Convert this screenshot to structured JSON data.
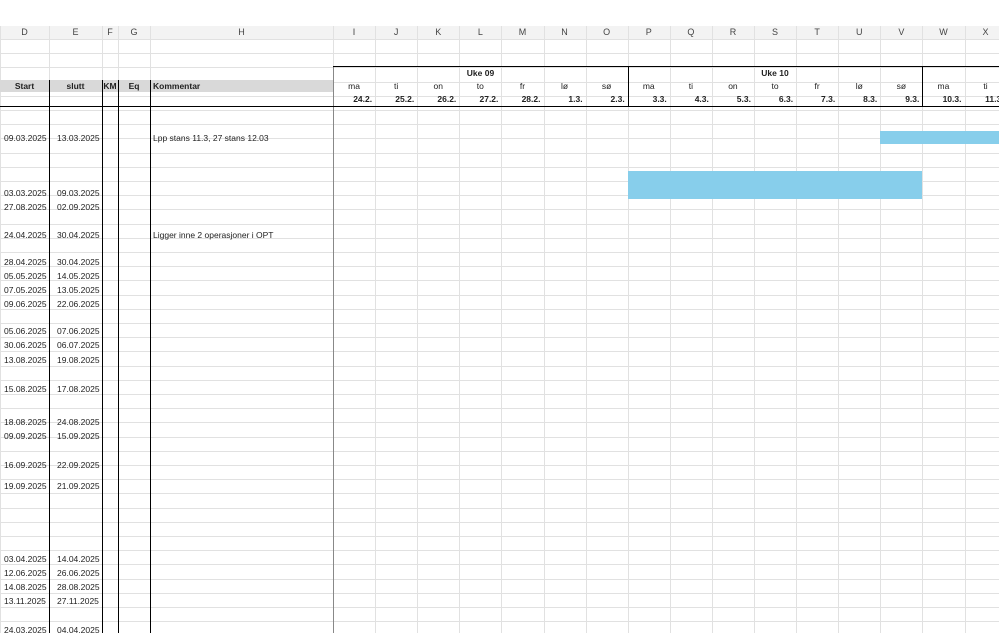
{
  "columns": {
    "letters": [
      "D",
      "E",
      "F",
      "G",
      "H",
      "I",
      "J",
      "K",
      "L",
      "M",
      "N",
      "O",
      "P",
      "Q",
      "R",
      "S",
      "T",
      "U",
      "V",
      "W",
      "X"
    ]
  },
  "headers": {
    "start": "Start",
    "slutt": "slutt",
    "km": "KM",
    "eq": "Eq",
    "kommentar": "Kommentar"
  },
  "weeks": [
    {
      "label": "Uke 09"
    },
    {
      "label": "Uke 10"
    }
  ],
  "days": [
    {
      "name": "ma",
      "date": "24.2."
    },
    {
      "name": "ti",
      "date": "25.2."
    },
    {
      "name": "on",
      "date": "26.2."
    },
    {
      "name": "to",
      "date": "27.2."
    },
    {
      "name": "fr",
      "date": "28.2."
    },
    {
      "name": "lø",
      "date": "1.3."
    },
    {
      "name": "sø",
      "date": "2.3."
    },
    {
      "name": "ma",
      "date": "3.3."
    },
    {
      "name": "ti",
      "date": "4.3."
    },
    {
      "name": "on",
      "date": "5.3."
    },
    {
      "name": "to",
      "date": "6.3."
    },
    {
      "name": "fr",
      "date": "7.3."
    },
    {
      "name": "lø",
      "date": "8.3."
    },
    {
      "name": "sø",
      "date": "9.3."
    },
    {
      "name": "ma",
      "date": "10.3."
    },
    {
      "name": "ti",
      "date": "11.3."
    }
  ],
  "rows": [
    {
      "start": "09.03.2025",
      "slutt": "13.03.2025",
      "kommentar": "Lpp stans 11.3, 27 stans 12.03"
    },
    {
      "start": "03.03.2025",
      "slutt": "09.03.2025",
      "kommentar": ""
    },
    {
      "start": "27.08.2025",
      "slutt": "02.09.2025",
      "kommentar": ""
    },
    {
      "start": "24.04.2025",
      "slutt": "30.04.2025",
      "kommentar": "Ligger inne 2 operasjoner i OPT"
    },
    {
      "start": "28.04.2025",
      "slutt": "30.04.2025",
      "kommentar": ""
    },
    {
      "start": "05.05.2025",
      "slutt": "14.05.2025",
      "kommentar": ""
    },
    {
      "start": "07.05.2025",
      "slutt": "13.05.2025",
      "kommentar": ""
    },
    {
      "start": "09.06.2025",
      "slutt": "22.06.2025",
      "kommentar": ""
    },
    {
      "start": "05.06.2025",
      "slutt": "07.06.2025",
      "kommentar": ""
    },
    {
      "start": "30.06.2025",
      "slutt": "06.07.2025",
      "kommentar": ""
    },
    {
      "start": "13.08.2025",
      "slutt": "19.08.2025",
      "kommentar": ""
    },
    {
      "start": "15.08.2025",
      "slutt": "17.08.2025",
      "kommentar": ""
    },
    {
      "start": "18.08.2025",
      "slutt": "24.08.2025",
      "kommentar": ""
    },
    {
      "start": "09.09.2025",
      "slutt": "15.09.2025",
      "kommentar": ""
    },
    {
      "start": "16.09.2025",
      "slutt": "22.09.2025",
      "kommentar": ""
    },
    {
      "start": "19.09.2025",
      "slutt": "21.09.2025",
      "kommentar": ""
    },
    {
      "start": "03.04.2025",
      "slutt": "14.04.2025",
      "kommentar": ""
    },
    {
      "start": "12.06.2025",
      "slutt": "26.06.2025",
      "kommentar": ""
    },
    {
      "start": "14.08.2025",
      "slutt": "28.08.2025",
      "kommentar": ""
    },
    {
      "start": "13.11.2025",
      "slutt": "27.11.2025",
      "kommentar": ""
    },
    {
      "start": "24.03.2025",
      "slutt": "04.04.2025",
      "kommentar": ""
    }
  ],
  "gantt_bars": [
    {
      "row_start": "09.03.2025",
      "from": "9.3.",
      "to": "11.3."
    },
    {
      "row_start": "03.03.2025",
      "from": "3.3.",
      "to": "9.3."
    }
  ],
  "colors": {
    "bar": "#87ceeb",
    "header_band": "#d9d9d9"
  }
}
